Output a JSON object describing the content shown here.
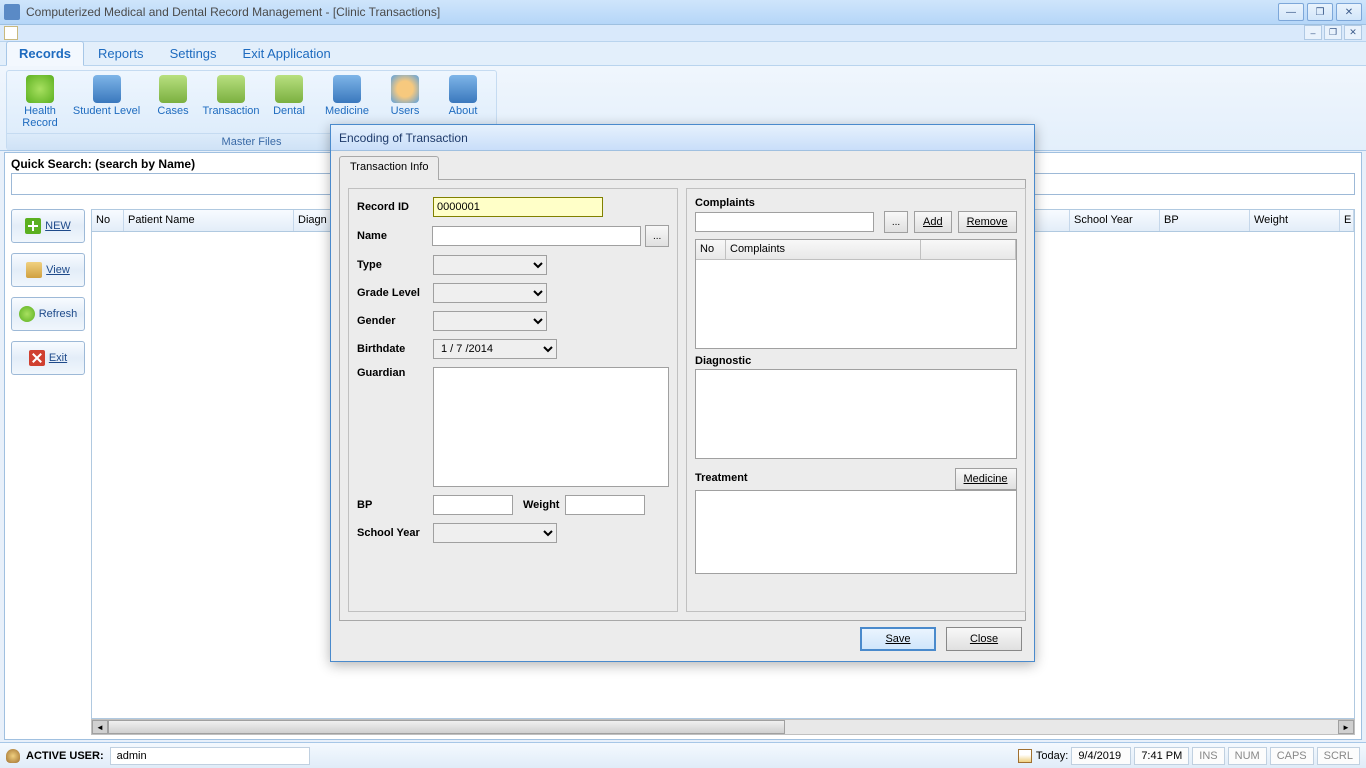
{
  "window": {
    "title": "Computerized Medical and Dental Record Management - [Clinic Transactions]"
  },
  "menu": {
    "records": "Records",
    "reports": "Reports",
    "settings": "Settings",
    "exit": "Exit Application"
  },
  "ribbon": {
    "group_label": "Master Files",
    "health_record": "Health Record",
    "student_level": "Student Level",
    "cases": "Cases",
    "transaction": "Transaction",
    "dental": "Dental",
    "medicine": "Medicine",
    "users": "Users",
    "about": "About"
  },
  "quicksearch": {
    "label": "Quick Search: (search by Name)",
    "value": ""
  },
  "sidebtns": {
    "new": "NEW",
    "view": "View",
    "refresh": "Refresh",
    "exit": "Exit"
  },
  "grid": {
    "headers": {
      "no": "No",
      "patient_name": "Patient Name",
      "diagn": "Diagn",
      "school_year": "School Year",
      "bp": "BP",
      "weight": "Weight",
      "extra": "E"
    }
  },
  "dialog": {
    "title": "Encoding of Transaction",
    "tab": "Transaction Info",
    "labels": {
      "record_id": "Record ID",
      "name": "Name",
      "type": "Type",
      "grade_level": "Grade Level",
      "gender": "Gender",
      "birthdate": "Birthdate",
      "guardian": "Guardian",
      "bp": "BP",
      "weight": "Weight",
      "school_year": "School Year",
      "complaints": "Complaints",
      "diagnostic": "Diagnostic",
      "treatment": "Treatment"
    },
    "values": {
      "record_id": "0000001",
      "name": "",
      "type": "",
      "grade_level": "",
      "gender": "",
      "birthdate": "1 / 7 /2014",
      "guardian": "",
      "bp": "",
      "weight": "",
      "school_year": "",
      "complaint_input": "",
      "diagnostic": "",
      "treatment": ""
    },
    "buttons": {
      "browse": "...",
      "add": "Add",
      "remove": "Remove",
      "medicine": "Medicine",
      "save": "Save",
      "close": "Close"
    },
    "complaint_grid": {
      "no": "No",
      "complaints": "Complaints"
    }
  },
  "status": {
    "active_user_label": "ACTIVE USER:",
    "active_user": "admin",
    "today_label": "Today:",
    "date": "9/4/2019",
    "time": "7:41 PM",
    "ins": "INS",
    "num": "NUM",
    "caps": "CAPS",
    "scrl": "SCRL"
  }
}
